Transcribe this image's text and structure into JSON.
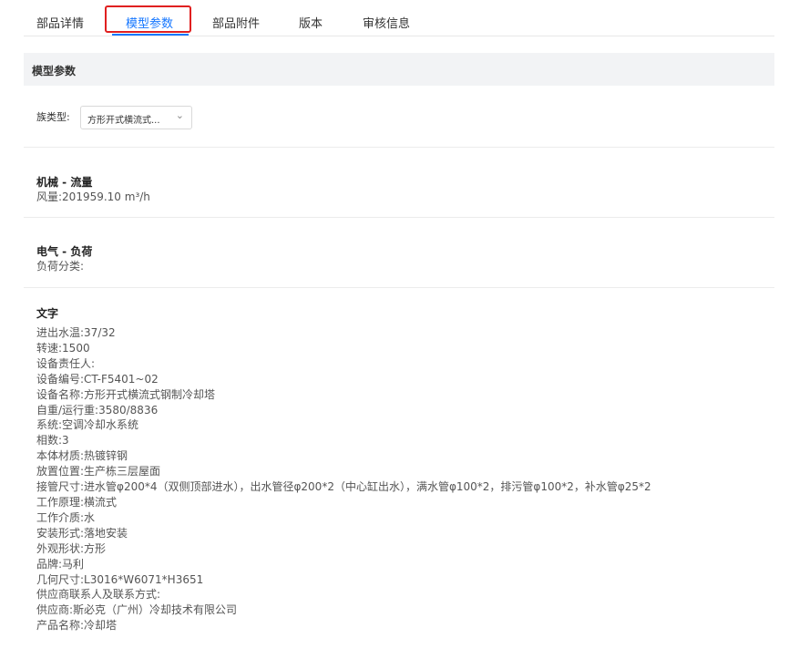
{
  "tabs": [
    {
      "label": "部品详情"
    },
    {
      "label": "模型参数",
      "active": true
    },
    {
      "label": "部品附件"
    },
    {
      "label": "版本"
    },
    {
      "label": "审核信息"
    }
  ],
  "colors": {
    "accent": "#1677ff",
    "highlight": "#e02020",
    "header_bg": "#f2f3f5"
  },
  "panel": {
    "title": "模型参数"
  },
  "family": {
    "label": "族类型:",
    "value": "方形开式横流式...",
    "icon": "chevron-down-icon"
  },
  "sections": [
    {
      "title": "机械 - 流量",
      "lines": [
        "风量:201959.10 m³/h"
      ]
    },
    {
      "title": "电气 - 负荷",
      "lines": [
        "负荷分类:"
      ]
    }
  ],
  "text_section": {
    "title": "文字",
    "lines": [
      "进出水温:37/32",
      "转速:1500",
      "设备责任人:",
      "设备编号:CT-F5401~02",
      "设备名称:方形开式横流式钢制冷却塔",
      "自重/运行重:3580/8836",
      "系统:空调冷却水系统",
      "相数:3",
      "本体材质:热镀锌钢",
      "放置位置:生产栋三层屋面",
      "接管尺寸:进水管φ200*4（双侧顶部进水），出水管径φ200*2（中心缸出水），满水管φ100*2，排污管φ100*2，补水管φ25*2",
      "工作原理:横流式",
      "工作介质:水",
      "安装形式:落地安装",
      "外观形状:方形",
      "品牌:马利",
      "几何尺寸:L3016*W6071*H3651",
      "供应商联系人及联系方式:",
      "供应商:斯必克（广州）冷却技术有限公司",
      "产品名称:冷却塔"
    ]
  }
}
